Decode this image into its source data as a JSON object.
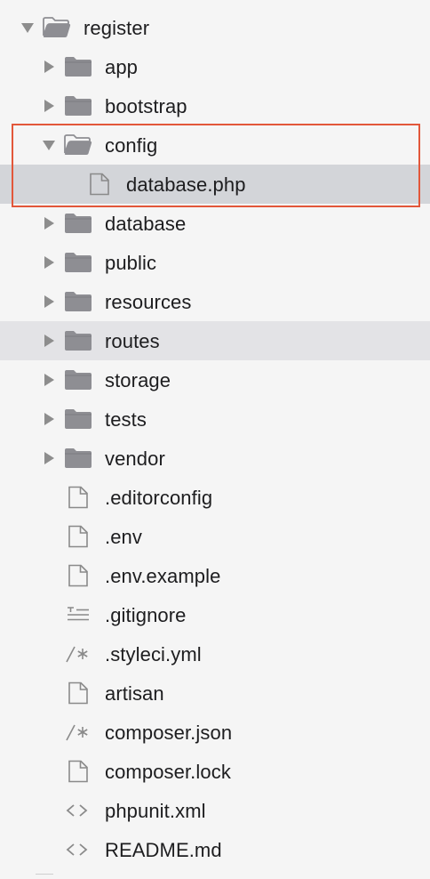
{
  "tree": [
    {
      "label": "register",
      "type": "folder",
      "level": 0,
      "state": "expanded",
      "icon": "folder-open-icon"
    },
    {
      "label": "app",
      "type": "folder",
      "level": 1,
      "state": "collapsed",
      "icon": "folder-icon"
    },
    {
      "label": "bootstrap",
      "type": "folder",
      "level": 1,
      "state": "collapsed",
      "icon": "folder-icon"
    },
    {
      "label": "config",
      "type": "folder",
      "level": 1,
      "state": "expanded",
      "icon": "folder-open-icon"
    },
    {
      "label": "database.php",
      "type": "file",
      "level": 2,
      "icon": "file-icon",
      "selected": true
    },
    {
      "label": "database",
      "type": "folder",
      "level": 1,
      "state": "collapsed",
      "icon": "folder-icon"
    },
    {
      "label": "public",
      "type": "folder",
      "level": 1,
      "state": "collapsed",
      "icon": "folder-icon"
    },
    {
      "label": "resources",
      "type": "folder",
      "level": 1,
      "state": "collapsed",
      "icon": "folder-icon"
    },
    {
      "label": "routes",
      "type": "folder",
      "level": 1,
      "state": "collapsed",
      "icon": "folder-icon",
      "hovered": true
    },
    {
      "label": "storage",
      "type": "folder",
      "level": 1,
      "state": "collapsed",
      "icon": "folder-icon"
    },
    {
      "label": "tests",
      "type": "folder",
      "level": 1,
      "state": "collapsed",
      "icon": "folder-icon"
    },
    {
      "label": "vendor",
      "type": "folder",
      "level": 1,
      "state": "collapsed",
      "icon": "folder-icon"
    },
    {
      "label": ".editorconfig",
      "type": "file",
      "level": 1,
      "icon": "file-icon"
    },
    {
      "label": ".env",
      "type": "file",
      "level": 1,
      "icon": "file-icon"
    },
    {
      "label": ".env.example",
      "type": "file",
      "level": 1,
      "icon": "file-icon"
    },
    {
      "label": ".gitignore",
      "type": "file",
      "level": 1,
      "icon": "text-lines-icon"
    },
    {
      "label": ".styleci.yml",
      "type": "file",
      "level": 1,
      "icon": "comment-icon",
      "glyph": "/*"
    },
    {
      "label": "artisan",
      "type": "file",
      "level": 1,
      "icon": "file-icon"
    },
    {
      "label": "composer.json",
      "type": "file",
      "level": 1,
      "icon": "comment-icon",
      "glyph": "/*"
    },
    {
      "label": "composer.lock",
      "type": "file",
      "level": 1,
      "icon": "file-icon"
    },
    {
      "label": "phpunit.xml",
      "type": "file",
      "level": 1,
      "icon": "code-icon",
      "glyph": "<>"
    },
    {
      "label": "README.md",
      "type": "file",
      "level": 1,
      "icon": "code-icon",
      "glyph": "<>"
    }
  ],
  "colors": {
    "folder": "#8e8e93",
    "folder_open": "#8e8e93",
    "file_outline": "#8a8a8a",
    "selection": "#d3d5d9",
    "hover": "#e3e3e6",
    "highlight_box": "#e2573a",
    "text": "#1d1d1f"
  }
}
